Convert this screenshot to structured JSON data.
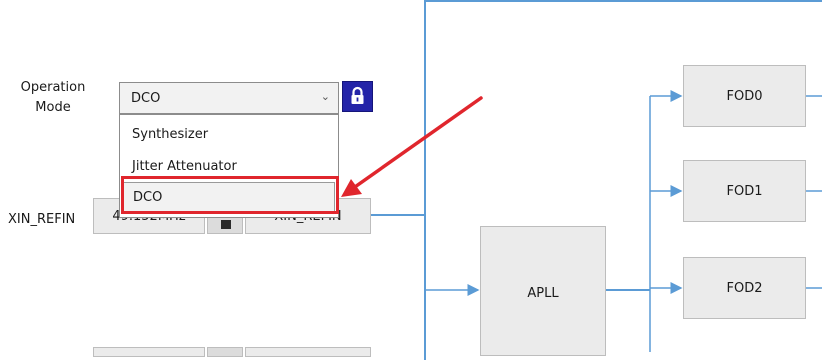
{
  "operation_mode": {
    "label_line1": "Operation",
    "label_line2": "Mode",
    "selected_value": "DCO",
    "options": [
      "Synthesizer",
      "Jitter Attenuator",
      "DCO"
    ]
  },
  "xin_refin": {
    "label": "XIN_REFIN",
    "value_partial": "49.152MHz",
    "source_partial": "XIN_REFIN"
  },
  "diagram": {
    "apll": "APLL",
    "fods": [
      "FOD0",
      "FOD1",
      "FOD2"
    ]
  },
  "colors": {
    "accent_blue": "#5b9bd5",
    "lock_button": "#2424a8",
    "annotation_red": "#e0262d"
  },
  "icons": {
    "lock": "lock-icon",
    "dropdown": "chevron-down-icon"
  }
}
